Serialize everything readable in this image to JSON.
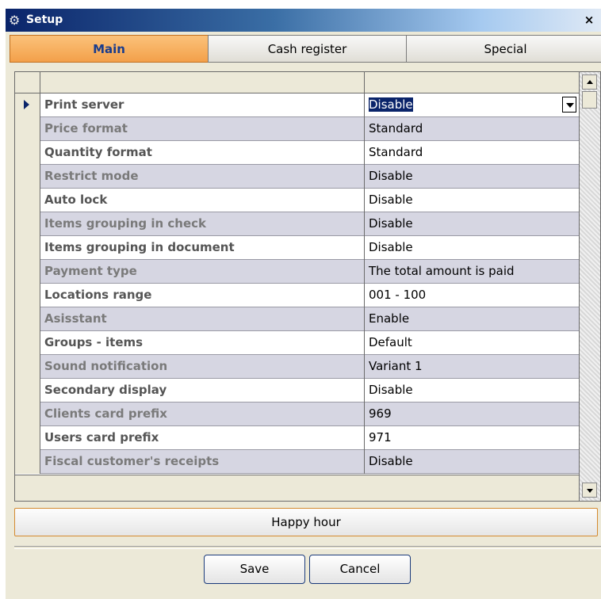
{
  "window": {
    "title": "Setup",
    "close_glyph": "×"
  },
  "tabs": [
    {
      "label": "Main",
      "active": true
    },
    {
      "label": "Cash register",
      "active": false
    },
    {
      "label": "Special",
      "active": false
    }
  ],
  "grid": {
    "headers": [
      "",
      ""
    ],
    "rows": [
      {
        "name": "Print server",
        "value": "Disable"
      },
      {
        "name": "Price format",
        "value": "Standard"
      },
      {
        "name": "Quantity format",
        "value": "Standard"
      },
      {
        "name": "Restrict mode",
        "value": "Disable"
      },
      {
        "name": "Auto lock",
        "value": "Disable"
      },
      {
        "name": "Items grouping in check",
        "value": "Disable"
      },
      {
        "name": "Items grouping in document",
        "value": "Disable"
      },
      {
        "name": "Payment type",
        "value": "The total amount is paid"
      },
      {
        "name": "Locations range",
        "value": "001 - 100"
      },
      {
        "name": "Asisstant",
        "value": "Enable"
      },
      {
        "name": "Groups - items",
        "value": "Default"
      },
      {
        "name": "Sound notification",
        "value": "Variant 1"
      },
      {
        "name": "Secondary display",
        "value": "Disable"
      },
      {
        "name": "Clients card prefix",
        "value": "969"
      },
      {
        "name": "Users card prefix",
        "value": "971"
      },
      {
        "name": "Fiscal customer's receipts",
        "value": "Disable"
      }
    ]
  },
  "buttons": {
    "happy_hour": "Happy hour",
    "save": "Save",
    "cancel": "Cancel"
  },
  "icons": {
    "title_icon": "gear-icon",
    "row_indicator": "arrow-right-icon",
    "dropdown": "chevron-down-icon"
  },
  "colors": {
    "title_bar": "#0a246a",
    "active_tab": "#f3a04a",
    "alt_row": "#d6d6e2"
  }
}
